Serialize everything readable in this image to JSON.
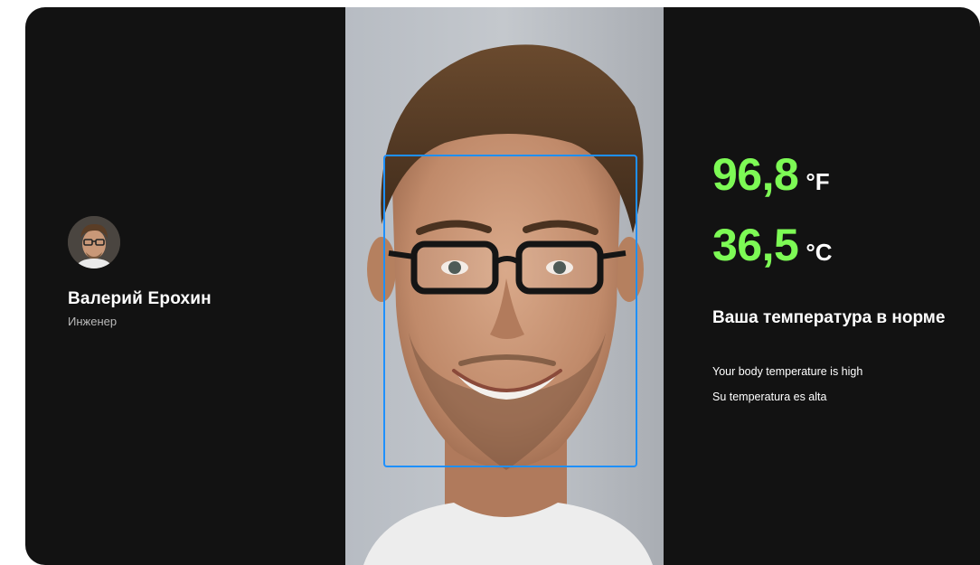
{
  "colors": {
    "background": "#121212",
    "accent_temperature": "#7dfa55",
    "face_frame": "#1e90ff",
    "text_primary": "#ffffff",
    "text_secondary": "#b9b9b9"
  },
  "user": {
    "name": "Валерий Ерохин",
    "role": "Инженер",
    "avatar_icon": "user-avatar-photo"
  },
  "camera": {
    "subject": "face-photo",
    "detection": "face-detection-frame"
  },
  "temperature": {
    "fahrenheit_value": "96,8",
    "fahrenheit_unit": "°F",
    "celsius_value": "36,5",
    "celsius_unit": "°C"
  },
  "status": {
    "title_ru": "Ваша температура в норме",
    "line_en": "Your body temperature is high",
    "line_es": "Su temperatura es alta"
  }
}
